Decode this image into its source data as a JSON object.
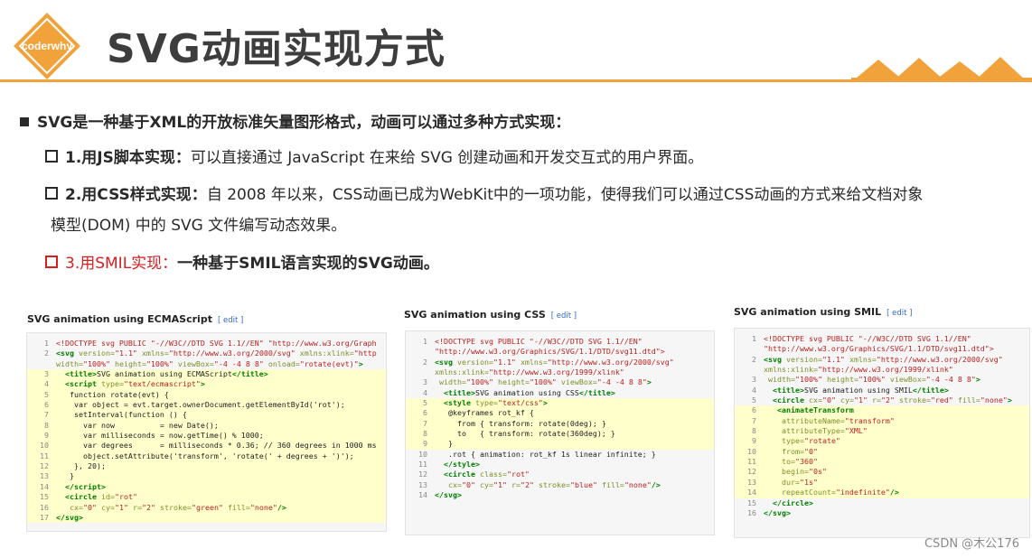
{
  "header": {
    "logo_text": "coderwhy",
    "title": "SVG动画实现方式"
  },
  "main_bullet": "SVG是一种基于XML的开放标准矢量图形格式，动画可以通过多种方式实现：",
  "items": [
    {
      "label": "1.用JS脚本实现：",
      "text": "可以直接通过 JavaScript 在来给 SVG 创建动画和开发交互式的用户界面。"
    },
    {
      "label": "2.用CSS样式实现：",
      "text": "自 2008 年以来，CSS动画已成为WebKit中的一项功能，使得我们可以通过CSS动画的方式来给文档对象",
      "text2": "模型(DOM) 中的 SVG 文件编写动态效果。"
    },
    {
      "label": "3.用SMIL实现：",
      "text": "一种基于SMIL语言实现的SVG动画。"
    }
  ],
  "examples": [
    {
      "title": "SVG animation using ECMAScript",
      "edit": "[ edit ]",
      "lines": [
        {
          "n": "1",
          "hl": false,
          "html": "<span class='st'>&lt;!DOCTYPE svg PUBLIC \"-//W3C//DTD SVG 1.1//EN\" \"http://www.w3.org/Graph</span>"
        },
        {
          "n": "2",
          "hl": false,
          "html": "<span class='tg'>&lt;svg</span> <span class='at'>version=</span><span class='st'>\"1.1\"</span> <span class='at'>xmlns=</span><span class='st'>\"http://www.w3.org/2000/svg\"</span> <span class='at'>xmlns:xlink=</span><span class='st'>\"http</span>"
        },
        {
          "n": "",
          "hl": false,
          "html": "<span class='at'>width=</span><span class='st'>\"100%\"</span> <span class='at'>height=</span><span class='st'>\"100%\"</span> <span class='at'>viewBox=</span><span class='st'>\"-4 -4 8 8\"</span> <span class='at'>onload=</span><span class='st'>\"rotate(evt)\"</span><span class='tg'>&gt;</span>"
        },
        {
          "n": "3",
          "hl": true,
          "html": "  <span class='tg'>&lt;title&gt;</span>SVG animation using ECMAScript<span class='tg'>&lt;/title&gt;</span>"
        },
        {
          "n": "4",
          "hl": true,
          "html": "  <span class='tg'>&lt;script</span> <span class='at'>type=</span><span class='st'>\"text/ecmascript\"</span><span class='tg'>&gt;</span>"
        },
        {
          "n": "5",
          "hl": true,
          "html": "   function rotate(evt) {"
        },
        {
          "n": "6",
          "hl": true,
          "html": "    var object = evt.target.ownerDocument.getElementById('rot');"
        },
        {
          "n": "7",
          "hl": true,
          "html": "    setInterval(function () {"
        },
        {
          "n": "8",
          "hl": true,
          "html": "      var now          = new Date();"
        },
        {
          "n": "9",
          "hl": true,
          "html": "      var milliseconds = now.getTime() % 1000;"
        },
        {
          "n": "10",
          "hl": true,
          "html": "      var degrees      = milliseconds * 0.36; // 360 degrees in 1000 ms"
        },
        {
          "n": "11",
          "hl": true,
          "html": "      object.setAttribute('transform', 'rotate(' + degrees + ')');"
        },
        {
          "n": "12",
          "hl": true,
          "html": "    }, 20);"
        },
        {
          "n": "13",
          "hl": true,
          "html": "   }"
        },
        {
          "n": "14",
          "hl": true,
          "html": "  <span class='tg'>&lt;/script&gt;</span>"
        },
        {
          "n": "15",
          "hl": true,
          "html": "  <span class='tg'>&lt;circle</span> <span class='at'>id=</span><span class='st'>\"rot\"</span>"
        },
        {
          "n": "16",
          "hl": true,
          "html": "   <span class='at'>cx=</span><span class='st'>\"0\"</span> <span class='at'>cy=</span><span class='st'>\"1\"</span> <span class='at'>r=</span><span class='st'>\"2\"</span> <span class='at'>stroke=</span><span class='st'>\"green\"</span> <span class='at'>fill=</span><span class='st'>\"none\"</span><span class='tg'>/&gt;</span>"
        },
        {
          "n": "17",
          "hl": true,
          "html": "<span class='tg'>&lt;/svg&gt;</span>"
        }
      ]
    },
    {
      "title": "SVG animation using CSS",
      "edit": "[ edit ]",
      "lines": [
        {
          "n": "1",
          "hl": false,
          "html": "<span class='st'>&lt;!DOCTYPE svg PUBLIC \"-//W3C//DTD SVG 1.1//EN\"</span>"
        },
        {
          "n": "",
          "hl": false,
          "html": "<span class='st'>\"http://www.w3.org/Graphics/SVG/1.1/DTD/svg11.dtd\"&gt;</span>"
        },
        {
          "n": "2",
          "hl": false,
          "html": "<span class='tg'>&lt;svg</span> <span class='at'>version=</span><span class='st'>\"1.1\"</span> <span class='at'>xmlns=</span><span class='st'>\"http://www.w3.org/2000/svg\"</span>"
        },
        {
          "n": "",
          "hl": false,
          "html": "<span class='at'>xmlns:xlink=</span><span class='st'>\"http://www.w3.org/1999/xlink\"</span>"
        },
        {
          "n": "3",
          "hl": false,
          "html": " <span class='at'>width=</span><span class='st'>\"100%\"</span> <span class='at'>height=</span><span class='st'>\"100%\"</span> <span class='at'>viewBox=</span><span class='st'>\"-4 -4 8 8\"</span><span class='tg'>&gt;</span>"
        },
        {
          "n": "4",
          "hl": false,
          "html": "  <span class='tg'>&lt;title&gt;</span>SVG animation using CSS<span class='tg'>&lt;/title&gt;</span>"
        },
        {
          "n": "5",
          "hl": true,
          "html": "  <span class='tg'>&lt;style</span> <span class='at'>type=</span><span class='st'>\"text/css\"</span><span class='tg'>&gt;</span>"
        },
        {
          "n": "6",
          "hl": true,
          "html": "   @keyframes rot_kf {"
        },
        {
          "n": "7",
          "hl": true,
          "html": "     from { transform: rotate(0deg); }"
        },
        {
          "n": "8",
          "hl": true,
          "html": "     to   { transform: rotate(360deg); }"
        },
        {
          "n": "9",
          "hl": true,
          "html": "   }"
        },
        {
          "n": "10",
          "hl": false,
          "html": "   .rot { animation: rot_kf 1s linear infinite; }"
        },
        {
          "n": "11",
          "hl": false,
          "html": "  <span class='tg'>&lt;/style&gt;</span>"
        },
        {
          "n": "12",
          "hl": false,
          "html": "  <span class='tg'>&lt;circle</span> <span class='at'>class=</span><span class='st'>\"rot\"</span>"
        },
        {
          "n": "13",
          "hl": false,
          "html": "   <span class='at'>cx=</span><span class='st'>\"0\"</span> <span class='at'>cy=</span><span class='st'>\"1\"</span> <span class='at'>r=</span><span class='st'>\"2\"</span> <span class='at'>stroke=</span><span class='st'>\"blue\"</span> <span class='at'>fill=</span><span class='st'>\"none\"</span><span class='tg'>/&gt;</span>"
        },
        {
          "n": "14",
          "hl": false,
          "html": "<span class='tg'>&lt;/svg&gt;</span>"
        }
      ]
    },
    {
      "title": "SVG animation using SMIL",
      "edit": "[ edit ]",
      "lines": [
        {
          "n": "1",
          "hl": false,
          "html": "<span class='st'>&lt;!DOCTYPE svg PUBLIC \"-//W3C//DTD SVG 1.1//EN\"</span>"
        },
        {
          "n": "",
          "hl": false,
          "html": "<span class='st'>\"http://www.w3.org/Graphics/SVG/1.1/DTD/svg11.dtd\"&gt;</span>"
        },
        {
          "n": "2",
          "hl": false,
          "html": "<span class='tg'>&lt;svg</span> <span class='at'>version=</span><span class='st'>\"1.1\"</span> <span class='at'>xmlns=</span><span class='st'>\"http://www.w3.org/2000/svg\"</span>"
        },
        {
          "n": "",
          "hl": false,
          "html": "<span class='at'>xmlns:xlink=</span><span class='st'>\"http://www.w3.org/1999/xlink\"</span>"
        },
        {
          "n": "3",
          "hl": false,
          "html": " <span class='at'>width=</span><span class='st'>\"100%\"</span> <span class='at'>height=</span><span class='st'>\"100%\"</span> <span class='at'>viewBox=</span><span class='st'>\"-4 -4 8 8\"</span><span class='tg'>&gt;</span>"
        },
        {
          "n": "4",
          "hl": false,
          "html": "  <span class='tg'>&lt;title&gt;</span>SVG animation using SMIL<span class='tg'>&lt;/title&gt;</span>"
        },
        {
          "n": "5",
          "hl": false,
          "html": "  <span class='tg'>&lt;circle</span> <span class='at'>cx=</span><span class='st'>\"0\"</span> <span class='at'>cy=</span><span class='st'>\"1\"</span> <span class='at'>r=</span><span class='st'>\"2\"</span> <span class='at'>stroke=</span><span class='st'>\"red\"</span> <span class='at'>fill=</span><span class='st'>\"none\"</span><span class='tg'>&gt;</span>"
        },
        {
          "n": "6",
          "hl": true,
          "html": "   <span class='tg'>&lt;animateTransform</span>"
        },
        {
          "n": "7",
          "hl": true,
          "html": "    <span class='at'>attributeName=</span><span class='st'>\"transform\"</span>"
        },
        {
          "n": "8",
          "hl": true,
          "html": "    <span class='at'>attributeType=</span><span class='st'>\"XML\"</span>"
        },
        {
          "n": "9",
          "hl": true,
          "html": "    <span class='at'>type=</span><span class='st'>\"rotate\"</span>"
        },
        {
          "n": "10",
          "hl": true,
          "html": "    <span class='at'>from=</span><span class='st'>\"0\"</span>"
        },
        {
          "n": "11",
          "hl": true,
          "html": "    <span class='at'>to=</span><span class='st'>\"360\"</span>"
        },
        {
          "n": "12",
          "hl": true,
          "html": "    <span class='at'>begin=</span><span class='st'>\"0s\"</span>"
        },
        {
          "n": "13",
          "hl": true,
          "html": "    <span class='at'>dur=</span><span class='st'>\"1s\"</span>"
        },
        {
          "n": "14",
          "hl": true,
          "html": "    <span class='at'>repeatCount=</span><span class='st'>\"indefinite\"</span><span class='tg'>/&gt;</span>"
        },
        {
          "n": "15",
          "hl": false,
          "html": "  <span class='tg'>&lt;/circle&gt;</span>"
        },
        {
          "n": "16",
          "hl": false,
          "html": "<span class='tg'>&lt;/svg&gt;</span>"
        }
      ]
    }
  ],
  "watermark": "CSDN @木公176",
  "colors": {
    "accent": "#f2a23a",
    "highlight": "#ffffcc",
    "red": "#d62020"
  }
}
